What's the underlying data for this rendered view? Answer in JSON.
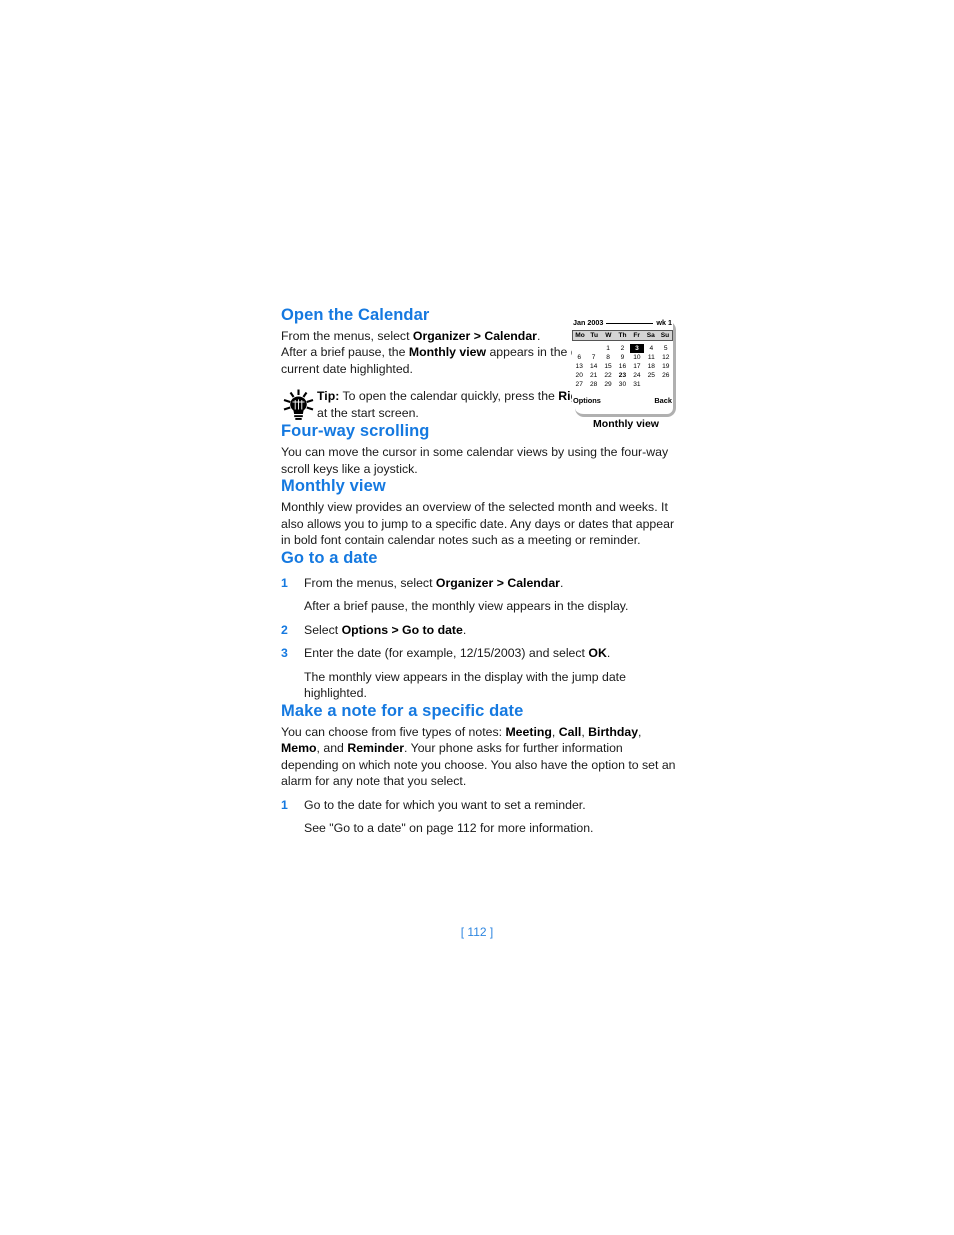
{
  "page": {
    "number_label": "[ 112 ]",
    "accent_color": "#1579e0",
    "page_number_color": "#2e86e0"
  },
  "sections": {
    "open_calendar": {
      "heading": "Open the Calendar",
      "line1_pre": "From the menus, select ",
      "line1_bold": "Organizer > Calendar",
      "line1_post": ".",
      "line2_pre": " After a brief pause, the ",
      "line2_bold": "Monthly view",
      "line2_post": " appears in the display with the current date highlighted.",
      "tip": {
        "label": "Tip:",
        "text_pre": " To open the calendar quickly, press the ",
        "text_bold": "Right selection",
        "text_post": " key at the start screen.",
        "icon": "lightbulb-icon"
      }
    },
    "four_way_scrolling": {
      "heading": "Four-way scrolling",
      "body": "You can move the cursor in some calendar views by using the four-way scroll keys like a joystick."
    },
    "monthly_view": {
      "heading": "Monthly view",
      "body": "Monthly view provides an overview of the selected month and weeks. It also allows you to jump to a specific date. Any days or dates that appear in bold font contain calendar notes such as a meeting or reminder."
    },
    "go_to_a_date": {
      "heading": "Go to a date",
      "steps": [
        {
          "num": "1",
          "pre": "From the menus, select ",
          "bold": "Organizer > Calendar",
          "post": ".",
          "sub": "After a brief pause, the monthly view appears in the display."
        },
        {
          "num": "2",
          "pre": "Select ",
          "bold": "Options > Go to date",
          "post": ".",
          "sub": ""
        },
        {
          "num": "3",
          "pre": "Enter the date (for example, 12/15/2003) and select ",
          "bold": "OK",
          "post": ".",
          "sub": "The monthly view appears in the display with the jump date highlighted."
        }
      ]
    },
    "make_note": {
      "heading": "Make a note for a specific date",
      "intro_pre": "You can choose from five types of notes: ",
      "note_types": [
        "Meeting",
        "Call",
        "Birthday",
        "Memo",
        "Reminder"
      ],
      "intro_mid": ", ",
      "intro_and": "and ",
      "intro_post": ". Your phone asks for further information depending on which note you choose. You also have the option to set an alarm for any note that you select.",
      "steps": [
        {
          "num": "1",
          "text": "Go to the date for which you want to set a reminder.",
          "sub": "See \"Go to a date\" on page 112 for more information."
        }
      ]
    }
  },
  "calendar_widget": {
    "caption": "Monthly view",
    "month_label": "Jan 2003",
    "week_label": "wk 1",
    "day_headers": [
      "Mo",
      "Tu",
      "W",
      "Th",
      "Fr",
      "Sa",
      "Su"
    ],
    "weeks": [
      [
        "",
        "",
        "1",
        "2",
        "3",
        "4",
        "5"
      ],
      [
        "6",
        "7",
        "8",
        "9",
        "10",
        "11",
        "12"
      ],
      [
        "13",
        "14",
        "15",
        "16",
        "17",
        "18",
        "19"
      ],
      [
        "20",
        "21",
        "22",
        "23",
        "24",
        "25",
        "26"
      ],
      [
        "27",
        "28",
        "29",
        "30",
        "31",
        "",
        ""
      ]
    ],
    "selected_date": "3",
    "bold_dates": [
      "23"
    ],
    "left_softkey": "Options",
    "right_softkey": "Back"
  }
}
